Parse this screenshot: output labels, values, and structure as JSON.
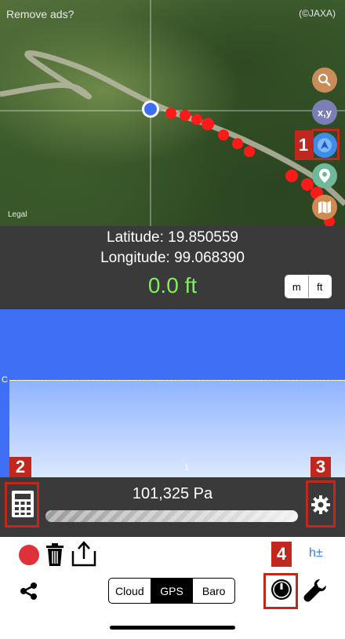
{
  "map": {
    "remove_ads": "Remove ads?",
    "attribution": "(©JAXA)",
    "legal": "Legal",
    "xy_label": "x,y",
    "buttons": [
      "search-icon",
      "xy-coordinates-icon",
      "compass-icon",
      "location-pin-icon",
      "map-icon"
    ]
  },
  "info": {
    "latitude": "Latitude: 19.850559",
    "longitude": "Longitude: 99.068390",
    "altitude": "0.0 ft",
    "unit_m": "m",
    "unit_ft": "ft",
    "selected_unit": "ft"
  },
  "graph": {
    "left_label": "C",
    "bottom_label": "1"
  },
  "pressure": {
    "value": "101,325 Pa"
  },
  "toolbar": {
    "h_plus_minus": "h±",
    "segments": [
      "Cloud",
      "GPS",
      "Baro"
    ],
    "active_segment": "GPS"
  },
  "markers": {
    "m1": "1",
    "m2": "2",
    "m3": "3",
    "m4": "4"
  },
  "colors": {
    "accent_red": "#c0281f",
    "altitude_green": "#7ff05b",
    "link_blue": "#2a7ef0",
    "track_red": "#ff1a1a",
    "graph_blue": "#3f6ff5"
  }
}
